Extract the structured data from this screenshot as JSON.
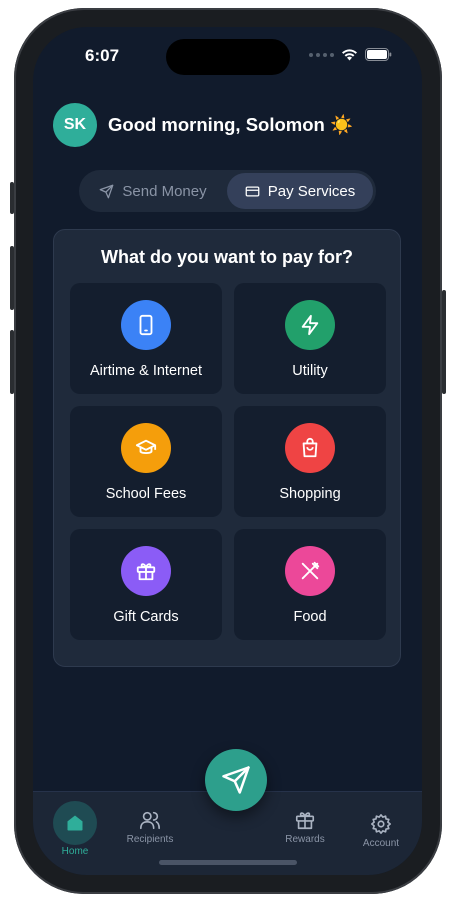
{
  "status_bar": {
    "time": "6:07"
  },
  "header": {
    "avatar_initials": "SK",
    "greeting": "Good morning, Solomon ☀️"
  },
  "toggle": {
    "send_label": "Send Money",
    "pay_label": "Pay Services",
    "selected": "Pay Services"
  },
  "panel": {
    "title": "What do you want to pay for?",
    "services": [
      {
        "label": "Airtime & Internet",
        "icon": "phone-icon",
        "color": "#3b82f6"
      },
      {
        "label": "Utility",
        "icon": "lightning-icon",
        "color": "#22a06b"
      },
      {
        "label": "School Fees",
        "icon": "graduation-cap-icon",
        "color": "#f59e0b"
      },
      {
        "label": "Shopping",
        "icon": "shopping-bag-icon",
        "color": "#ef4444"
      },
      {
        "label": "Gift Cards",
        "icon": "gift-icon",
        "color": "#8b5cf6"
      },
      {
        "label": "Food",
        "icon": "utensils-icon",
        "color": "#ec4899"
      }
    ]
  },
  "tabbar": {
    "home": "Home",
    "recipients": "Recipients",
    "rewards": "Rewards",
    "account": "Account",
    "active_tab": "Home"
  },
  "colors": {
    "accent": "#2fae9a",
    "background": "#111b2c",
    "card": "#1f2a3b"
  }
}
